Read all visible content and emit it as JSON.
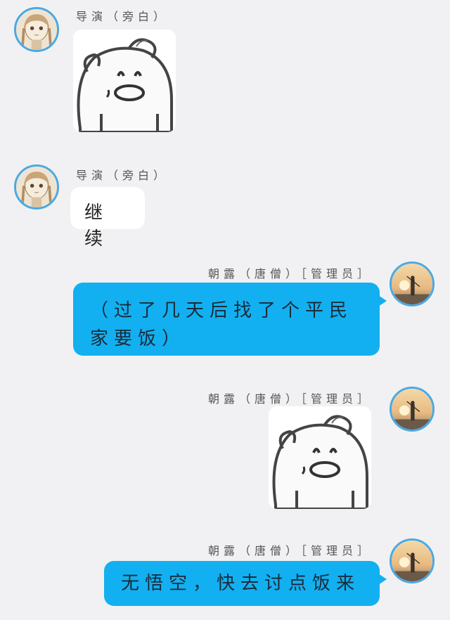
{
  "messages": [
    {
      "side": "left",
      "sender": "导演（旁白）",
      "kind": "sticker",
      "sticker": "bear-face-sticker"
    },
    {
      "side": "left",
      "sender": "导演（旁白）",
      "kind": "text",
      "text": "继续"
    },
    {
      "side": "right",
      "sender": "朝露（唐僧）［管理员］",
      "kind": "text",
      "text": "（过了几天后找了个平民家要饭）"
    },
    {
      "side": "right",
      "sender": "朝露（唐僧）［管理员］",
      "kind": "sticker",
      "sticker": "bear-face-sticker"
    },
    {
      "side": "right",
      "sender": "朝露（唐僧）［管理员］",
      "kind": "text",
      "text": "无悟空，快去讨点饭来"
    }
  ],
  "colors": {
    "background": "#f1f1f3",
    "bubble_blue": "#12b0f0",
    "bubble_white": "#ffffff",
    "avatar_ring": "#4aa9e4"
  }
}
